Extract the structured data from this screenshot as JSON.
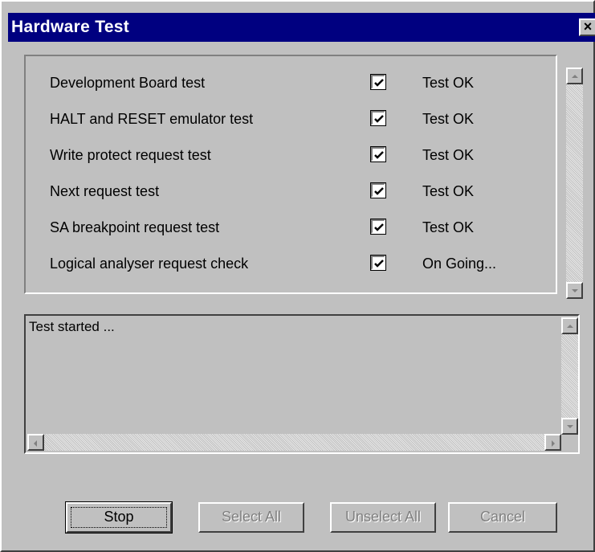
{
  "window": {
    "title": "Hardware Test",
    "close_icon": "close-icon"
  },
  "tests": [
    {
      "name": "Development Board test",
      "checked": true,
      "status": "Test OK"
    },
    {
      "name": "HALT and RESET emulator test",
      "checked": true,
      "status": "Test OK"
    },
    {
      "name": "Write protect request test",
      "checked": true,
      "status": "Test OK"
    },
    {
      "name": "Next request test",
      "checked": true,
      "status": "Test OK"
    },
    {
      "name": "SA breakpoint request test",
      "checked": true,
      "status": "Test OK"
    },
    {
      "name": "Logical analyser request check",
      "checked": true,
      "status": "On Going..."
    }
  ],
  "log": {
    "text": "Test started ..."
  },
  "buttons": {
    "stop": "Stop",
    "select_all": "Select All",
    "unselect_all": "Unselect All",
    "cancel": "Cancel"
  },
  "colors": {
    "titlebar": "#000080",
    "face": "#c0c0c0"
  }
}
